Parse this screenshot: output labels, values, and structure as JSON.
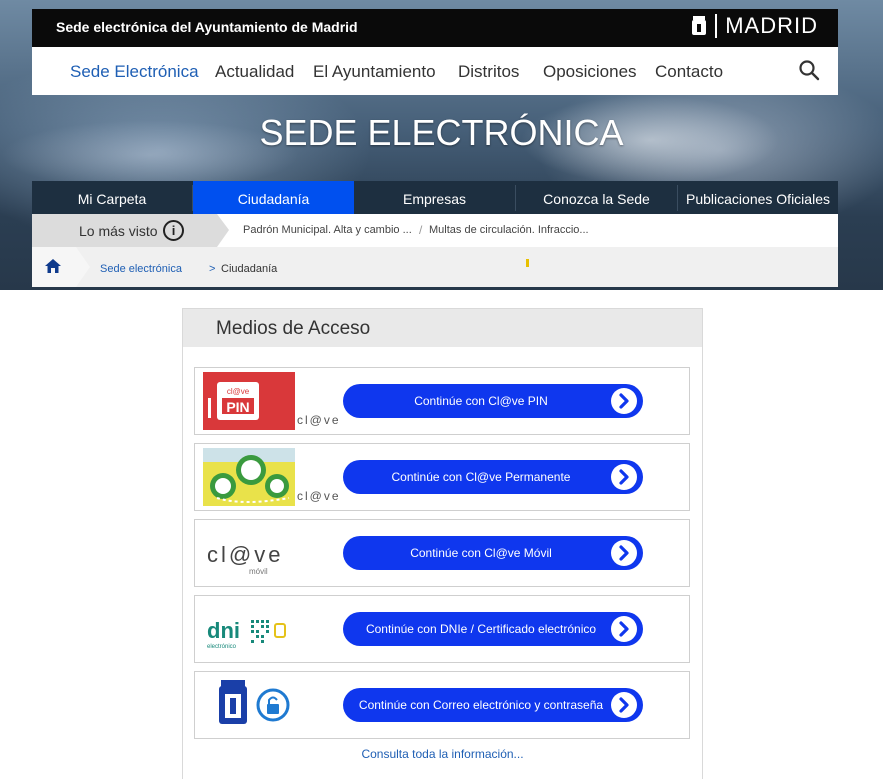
{
  "topbar": {
    "site_title": "Sede electrónica del Ayuntamiento de Madrid",
    "brand": "MADRID"
  },
  "nav": {
    "items": [
      "Sede Electrónica",
      "Actualidad",
      "El Ayuntamiento",
      "Distritos",
      "Oposiciones",
      "Contacto"
    ],
    "active": "Sede Electrónica"
  },
  "hero": {
    "title": "SEDE ELECTRÓNICA"
  },
  "tabs": {
    "items": [
      "Mi Carpeta",
      "Ciudadanía",
      "Empresas",
      "Conozca la Sede",
      "Publicaciones Oficiales"
    ],
    "active": "Ciudadanía"
  },
  "most_seen": {
    "label": "Lo más visto",
    "links": [
      "Padrón Municipal. Alta y cambio ...",
      "Multas de circulación. Infraccio..."
    ]
  },
  "breadcrumb": {
    "items": [
      "Sede electrónica",
      "Ciudadanía"
    ],
    "separator": ">"
  },
  "panel": {
    "title": "Medios de Acceso",
    "options": [
      {
        "label": "Continúe con Cl@ve PIN",
        "icon": "clave-pin-logo"
      },
      {
        "label": "Continúe con Cl@ve Permanente",
        "icon": "clave-permanente-logo"
      },
      {
        "label": "Continúe con Cl@ve Móvil",
        "icon": "clave-movil-logo"
      },
      {
        "label": "Continúe con DNIe / Certificado electrónico",
        "icon": "dnie-logo"
      },
      {
        "label": "Continúe con Correo electrónico y contraseña",
        "icon": "madrid-shield-lock-logo"
      }
    ],
    "more_link": "Consulta toda la información..."
  },
  "logo_text": {
    "clave": "cl@ve",
    "pin": "PIN",
    "movil": "móvil",
    "dni": "dni",
    "dni_sub": "electrónico"
  },
  "colors": {
    "accent": "#0f37ee",
    "tab_active": "#0050ef",
    "link": "#1f5fb4",
    "dark_bar": "#1d2f40"
  }
}
